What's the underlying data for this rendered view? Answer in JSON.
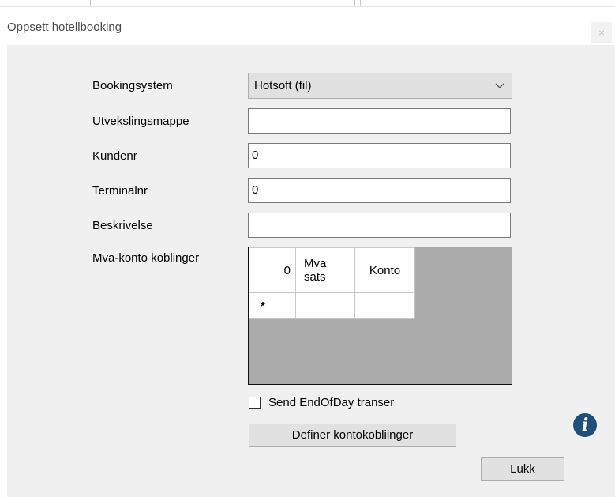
{
  "window": {
    "title": "Oppsett hotellbooking",
    "close_glyph": "×"
  },
  "form": {
    "bookingsystem_label": "Bookingsystem",
    "bookingsystem_value": "Hotsoft (fil)",
    "utvekslingsmappe_label": "Utvekslingsmappe",
    "utvekslingsmappe_value": "",
    "kundenr_label": "Kundenr",
    "kundenr_value": "0",
    "terminalnr_label": "Terminalnr",
    "terminalnr_value": "0",
    "beskrivelse_label": "Beskrivelse",
    "beskrivelse_value": "",
    "mva_label": "Mva-konto koblinger"
  },
  "grid": {
    "corner_value": "0",
    "columns": [
      "Mva sats",
      "Konto"
    ],
    "new_row_marker": "*"
  },
  "send_eod": {
    "label": "Send EndOfDay transer",
    "checked": false
  },
  "buttons": {
    "define_label": "Definer kontokobliinger",
    "close_label": "Lukk",
    "info_glyph": "i"
  },
  "icons": [
    "chevron-down-icon",
    "info-icon",
    "close-icon"
  ]
}
